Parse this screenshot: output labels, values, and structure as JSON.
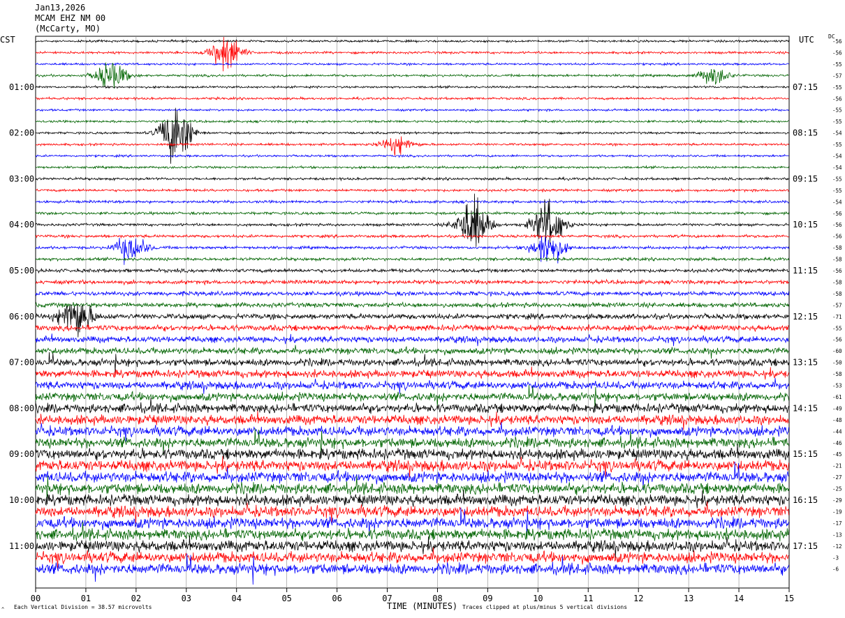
{
  "header": {
    "date": "Jan13,2026",
    "station": "MCAM EHZ NM 00",
    "location": "(McCarty, MO)"
  },
  "left_zone": "CST",
  "right_zone": "UTC",
  "dc_label": "DC",
  "footer": {
    "left_note": "Each Vertical Division = 38.57 microvolts",
    "right_note": "Traces clipped at plus/minus 5 vertical divisions",
    "corner_mark": "^"
  },
  "colors": {
    "black": "#000000",
    "red": "#ff0000",
    "blue": "#0000ff",
    "green": "#006400",
    "grid": "#888888"
  },
  "chart_data": {
    "type": "line",
    "title": "",
    "xlabel": "TIME (MINUTES)",
    "ylabel": "",
    "x_ticks": [
      "00",
      "01",
      "02",
      "03",
      "04",
      "05",
      "06",
      "07",
      "08",
      "09",
      "10",
      "11",
      "12",
      "13",
      "14",
      "15"
    ],
    "xlim": [
      0,
      15
    ],
    "trace_interval_minutes": 15,
    "trace_color_cycle": [
      "black",
      "red",
      "blue",
      "green"
    ],
    "left_hour_labels": [
      "01:00",
      "02:00",
      "03:00",
      "04:00",
      "05:00",
      "06:00",
      "07:00",
      "08:00",
      "09:00",
      "10:00",
      "11:00"
    ],
    "right_hour_labels": [
      "07:15",
      "08:15",
      "09:15",
      "10:15",
      "11:15",
      "12:15",
      "13:15",
      "14:15",
      "15:15",
      "16:15",
      "17:15"
    ],
    "hour_label_trace_index": [
      4,
      8,
      12,
      16,
      20,
      24,
      28,
      32,
      36,
      40,
      44
    ],
    "dc_offsets": [
      -56,
      -56,
      -55,
      -57,
      -55,
      -56,
      -55,
      -55,
      -54,
      -55,
      -54,
      -54,
      -55,
      -55,
      -54,
      -56,
      -56,
      -56,
      -58,
      -58,
      -56,
      -58,
      -58,
      -57,
      -71,
      -55,
      -56,
      -60,
      -50,
      -58,
      -53,
      -61,
      -49,
      -48,
      -44,
      -46,
      -45,
      -21,
      -27,
      -25,
      -29,
      -19,
      -17,
      -13,
      -12,
      -3,
      -6
    ],
    "trace_noise_levels": [
      1.2,
      1.3,
      1.2,
      1.3,
      1.2,
      1.3,
      1.2,
      1.3,
      1.2,
      1.3,
      1.2,
      1.3,
      1.4,
      1.4,
      1.5,
      1.5,
      1.5,
      1.6,
      1.6,
      1.7,
      2.0,
      2.2,
      2.4,
      2.6,
      3.0,
      3.2,
      3.4,
      3.6,
      4.0,
      4.2,
      4.4,
      4.6,
      5.0,
      5.2,
      5.4,
      5.6,
      5.8,
      6.0,
      6.0,
      6.0,
      6.0,
      6.0,
      6.0,
      6.0,
      6.0,
      6.0,
      6.0
    ],
    "events": [
      {
        "trace": 1,
        "minute": 3.8,
        "amplitude": 5
      },
      {
        "trace": 3,
        "minute": 1.5,
        "amplitude": 4
      },
      {
        "trace": 3,
        "minute": 13.5,
        "amplitude": 2.5
      },
      {
        "trace": 8,
        "minute": 2.8,
        "amplitude": 9
      },
      {
        "trace": 9,
        "minute": 7.2,
        "amplitude": 2.5
      },
      {
        "trace": 16,
        "minute": 8.7,
        "amplitude": 8
      },
      {
        "trace": 16,
        "minute": 10.2,
        "amplitude": 7
      },
      {
        "trace": 18,
        "minute": 1.9,
        "amplitude": 4
      },
      {
        "trace": 18,
        "minute": 10.2,
        "amplitude": 5
      },
      {
        "trace": 24,
        "minute": 0.8,
        "amplitude": 6
      }
    ]
  }
}
